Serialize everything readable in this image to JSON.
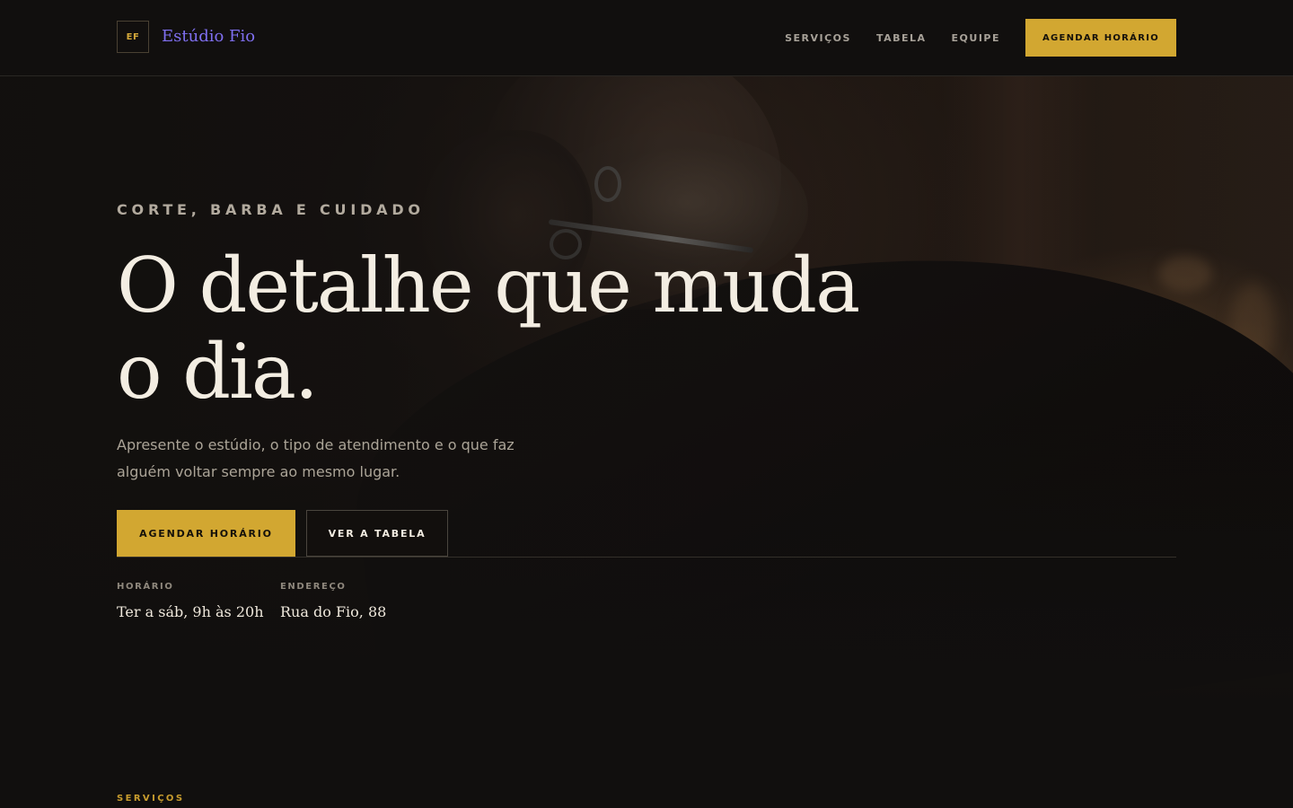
{
  "brand": {
    "mark": "EF",
    "name": "Estúdio Fio"
  },
  "nav": {
    "items": [
      {
        "label": "SERVIÇOS"
      },
      {
        "label": "TABELA"
      },
      {
        "label": "EQUIPE"
      }
    ],
    "cta_label": "AGENDAR HORÁRIO"
  },
  "hero": {
    "eyebrow": "CORTE, BARBA E CUIDADO",
    "title_line1": "O detalhe que muda",
    "title_line2": "o dia.",
    "subtitle": "Apresente o estúdio, o tipo de atendimento e o que faz alguém voltar sempre ao mesmo lugar.",
    "primary_button": "AGENDAR HORÁRIO",
    "secondary_button": "VER A TABELA",
    "info": {
      "hours_label": "HORÁRIO",
      "hours_value": "Ter a sáb, 9h às 20h",
      "address_label": "ENDEREÇO",
      "address_value": "Rua do Fio, 88"
    }
  },
  "next_section": {
    "eyebrow": "SERVIÇOS"
  },
  "colors": {
    "background": "#110f0e",
    "accent": "#d2a731",
    "brand_link": "#7f6ff0",
    "text_primary": "#f3ede2",
    "text_muted": "#aba497"
  }
}
